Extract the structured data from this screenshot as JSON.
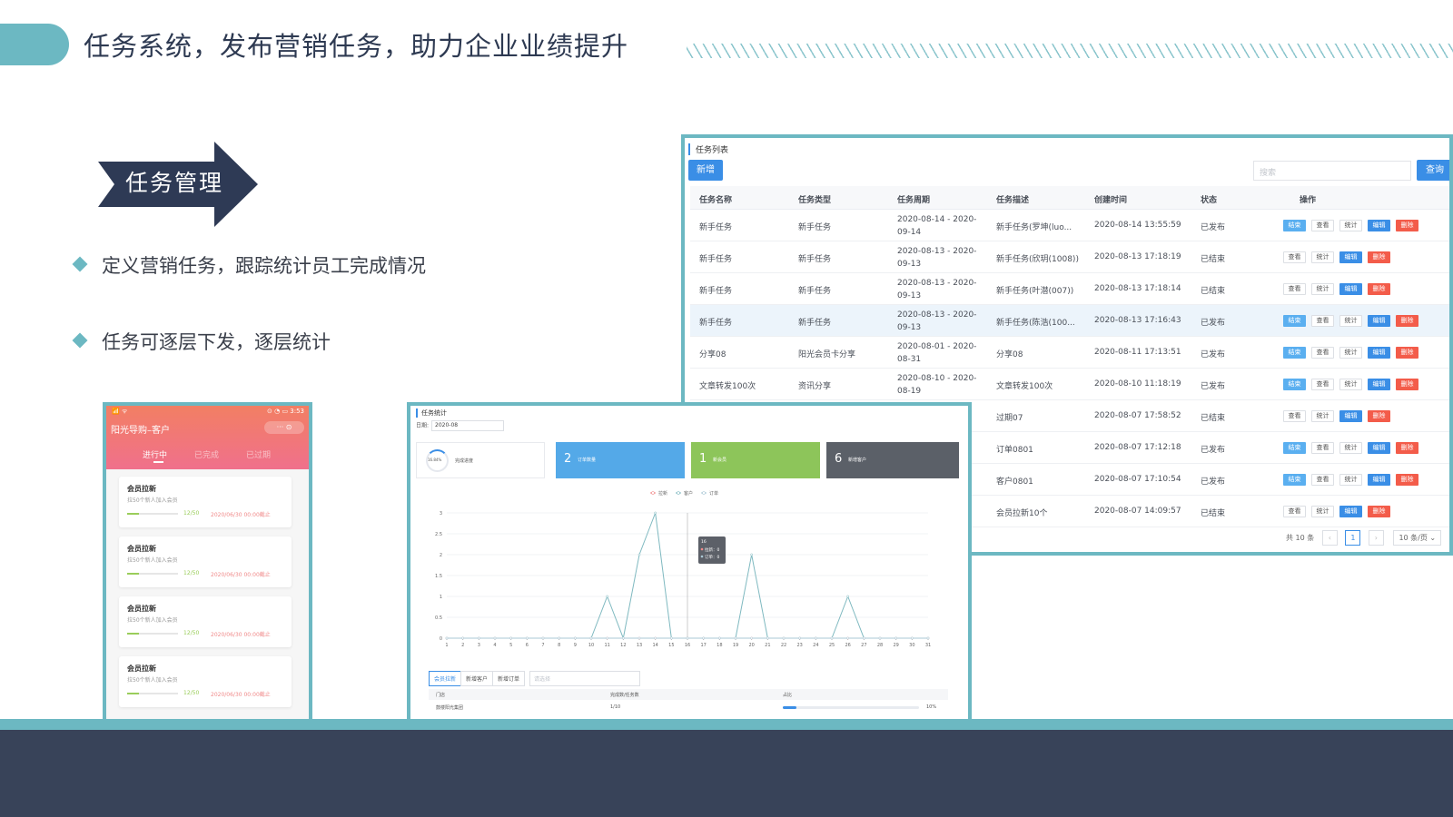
{
  "header": {
    "title": "任务系统，发布营销任务，助力企业业绩提升"
  },
  "intro": {
    "arrow_label": "任务管理",
    "bullets": [
      "定义营销任务，跟踪统计员工完成情况",
      "任务可逐层下发，逐层统计"
    ]
  },
  "colors": {
    "accent": "#6cb8c2",
    "navy": "#384359",
    "blue": "#3a8ee6",
    "red": "#f35c4a",
    "green": "#8dc55a",
    "gray": "#5b6068"
  },
  "task_list": {
    "title": "任务列表",
    "add_label": "新增",
    "search_placeholder": "搜索",
    "query_label": "查询",
    "columns": [
      "任务名称",
      "任务类型",
      "任务周期",
      "任务描述",
      "创建时间",
      "状态",
      "操作"
    ],
    "op_labels": {
      "end": "结束",
      "view": "查看",
      "stat": "统计",
      "edit": "编辑",
      "del": "删除"
    },
    "rows": [
      {
        "name": "新手任务",
        "type": "新手任务",
        "period": "2020-08-14 - 2020-09-14",
        "desc": "新手任务(罗坤(luo...",
        "created": "2020-08-14 13:55:59",
        "status": "已发布",
        "ops": [
          "end",
          "view",
          "stat",
          "edit",
          "del"
        ]
      },
      {
        "name": "新手任务",
        "type": "新手任务",
        "period": "2020-08-13 - 2020-09-13",
        "desc": "新手任务(欣玥(1008))",
        "created": "2020-08-13 17:18:19",
        "status": "已结束",
        "ops": [
          "view",
          "stat",
          "edit",
          "del"
        ]
      },
      {
        "name": "新手任务",
        "type": "新手任务",
        "period": "2020-08-13 - 2020-09-13",
        "desc": "新手任务(叶潜(007))",
        "created": "2020-08-13 17:18:14",
        "status": "已结束",
        "ops": [
          "view",
          "stat",
          "edit",
          "del"
        ]
      },
      {
        "name": "新手任务",
        "type": "新手任务",
        "period": "2020-08-13 - 2020-09-13",
        "desc": "新手任务(陈浩(100...",
        "created": "2020-08-13 17:16:43",
        "status": "已发布",
        "ops": [
          "end",
          "view",
          "stat",
          "edit",
          "del"
        ],
        "highlight": true
      },
      {
        "name": "分享08",
        "type": "阳光会员卡分享",
        "period": "2020-08-01 - 2020-08-31",
        "desc": "分享08",
        "created": "2020-08-11 17:13:51",
        "status": "已发布",
        "ops": [
          "end",
          "view",
          "stat",
          "edit",
          "del"
        ]
      },
      {
        "name": "文章转发100次",
        "type": "资讯分享",
        "period": "2020-08-10 - 2020-08-19",
        "desc": "文章转发100次",
        "created": "2020-08-10 11:18:19",
        "status": "已发布",
        "ops": [
          "end",
          "view",
          "stat",
          "edit",
          "del"
        ]
      },
      {
        "name": "",
        "type": "",
        "period": "",
        "desc": "过期07",
        "created": "2020-08-07 17:58:52",
        "status": "已结束",
        "ops": [
          "view",
          "stat",
          "edit",
          "del"
        ]
      },
      {
        "name": "",
        "type": "",
        "period": "",
        "desc": "订单0801",
        "created": "2020-08-07 17:12:18",
        "status": "已发布",
        "ops": [
          "end",
          "view",
          "stat",
          "edit",
          "del"
        ]
      },
      {
        "name": "",
        "type": "",
        "period": "",
        "desc": "客户0801",
        "created": "2020-08-07 17:10:54",
        "status": "已发布",
        "ops": [
          "end",
          "view",
          "stat",
          "edit",
          "del"
        ]
      },
      {
        "name": "",
        "type": "",
        "period": "",
        "desc": "会员拉新10个",
        "created": "2020-08-07 14:09:57",
        "status": "已结束",
        "ops": [
          "view",
          "stat",
          "edit",
          "del"
        ]
      }
    ],
    "pager": {
      "total": "共 10 条",
      "prev": "‹",
      "page": "1",
      "next": "›",
      "size": "10 条/页 ⌄"
    }
  },
  "stats": {
    "title": "任务统计",
    "date_label": "日期:",
    "date_value": "2020-08",
    "progress": {
      "value": "16.84%",
      "label": "完成进度"
    },
    "cards": [
      {
        "num": "2",
        "label": "订单数量",
        "color": "#54a9e8"
      },
      {
        "num": "1",
        "label": "新会员",
        "color": "#8dc55a"
      },
      {
        "num": "6",
        "label": "新增客户",
        "color": "#5b6068"
      }
    ],
    "tabs": [
      "会员拉新",
      "新增客户",
      "新增订单"
    ],
    "select_placeholder": "请选择",
    "table_head": [
      "门店",
      "完成数/任务数",
      "占比"
    ],
    "table_row": {
      "store": "鼓楼阳光集团",
      "done": "1/10",
      "pct": "10%",
      "fraction": 0.1
    }
  },
  "chart_data": {
    "type": "line",
    "x": [
      "1",
      "2",
      "3",
      "4",
      "5",
      "6",
      "7",
      "8",
      "9",
      "10",
      "11",
      "12",
      "13",
      "14",
      "15",
      "16",
      "17",
      "18",
      "19",
      "20",
      "21",
      "22",
      "23",
      "24",
      "25",
      "26",
      "27",
      "28",
      "29",
      "30",
      "31"
    ],
    "ylim": [
      0,
      3
    ],
    "yticks": [
      "0",
      "0.5",
      "1",
      "1.5",
      "2",
      "2.5",
      "3"
    ],
    "legend": "top-center",
    "series": [
      {
        "name": "拉新",
        "color": "#f08a8a",
        "values": [
          0,
          0,
          0,
          0,
          0,
          0,
          0,
          0,
          0,
          0,
          0,
          0,
          0,
          0,
          0,
          0,
          0,
          0,
          0,
          0,
          0,
          0,
          0,
          0,
          0,
          0,
          0,
          0,
          0,
          0,
          0
        ]
      },
      {
        "name": "客户",
        "color": "#7fb9c0",
        "values": [
          0,
          0,
          0,
          0,
          0,
          0,
          0,
          0,
          0,
          0,
          1,
          0,
          2,
          3,
          0,
          0,
          0,
          0,
          0,
          2,
          0,
          0,
          0,
          0,
          0,
          1,
          0,
          0,
          0,
          0,
          0
        ]
      },
      {
        "name": "订单",
        "color": "#aac8d6",
        "values": [
          0,
          0,
          0,
          0,
          0,
          0,
          0,
          0,
          0,
          0,
          0,
          0,
          0,
          0,
          0,
          0,
          0,
          0,
          0,
          0,
          0,
          0,
          0,
          0,
          0,
          0,
          0,
          0,
          0,
          0,
          0
        ]
      }
    ],
    "tooltip": {
      "x": "16",
      "lines": [
        "拉新：0",
        "订单：0"
      ]
    }
  },
  "phone": {
    "status_left": "📶 ᯤ",
    "status_right": "⊙ ◔ ▭ 3:53",
    "app_title": "阳光导购–客户",
    "ctrl": "··· ⊙",
    "tabs": [
      "进行中",
      "已完成",
      "已过期"
    ],
    "cards": [
      {
        "title": "会员拉新",
        "desc": "拉50个新人加入会员",
        "count": "12/50",
        "fraction": 0.24,
        "due": "2020/06/30 00:00截止"
      },
      {
        "title": "会员拉新",
        "desc": "拉50个新人加入会员",
        "count": "12/50",
        "fraction": 0.24,
        "due": "2020/06/30 00:00截止"
      },
      {
        "title": "会员拉新",
        "desc": "拉50个新人加入会员",
        "count": "12/50",
        "fraction": 0.24,
        "due": "2020/06/30 00:00截止"
      },
      {
        "title": "会员拉新",
        "desc": "拉50个新人加入会员",
        "count": "12/50",
        "fraction": 0.24,
        "due": "2020/06/30 00:00截止"
      }
    ]
  }
}
